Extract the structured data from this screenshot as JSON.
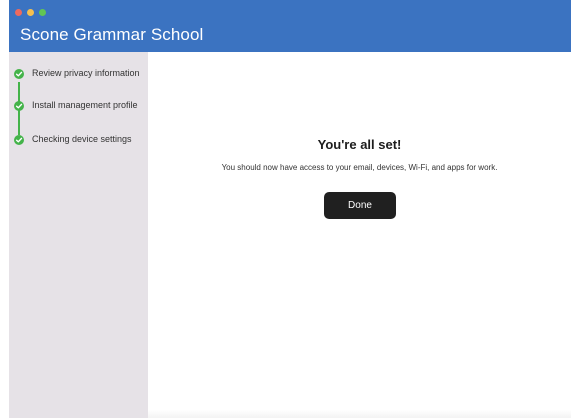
{
  "window": {
    "title": "Scone Grammar School",
    "controls": [
      "close",
      "minimize",
      "maximize"
    ],
    "colors": {
      "titlebar": "#3b73c1",
      "sidebar": "#e6e2e7",
      "step_complete": "#44b34a",
      "button": "#202020"
    }
  },
  "sidebar": {
    "steps": [
      {
        "label": "Review privacy information",
        "status": "complete",
        "icon": "checkmark-icon"
      },
      {
        "label": "Install management profile",
        "status": "complete",
        "icon": "checkmark-icon"
      },
      {
        "label": "Checking device settings",
        "status": "complete",
        "icon": "checkmark-icon"
      }
    ]
  },
  "main": {
    "heading": "You're all set!",
    "message": "You should now have access to your email, devices, Wi-Fi, and apps for work.",
    "done_label": "Done"
  }
}
